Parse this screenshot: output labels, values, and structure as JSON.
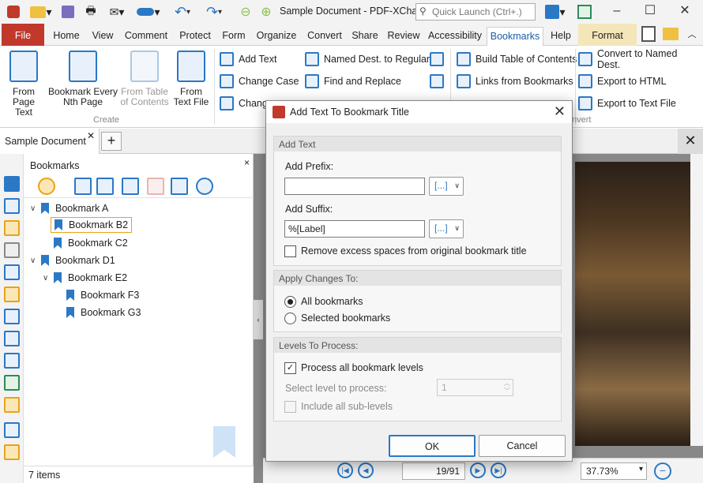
{
  "window": {
    "title": "Sample Document - PDF-XCha...",
    "quick_launch_placeholder": "Quick Launch (Ctrl+.)",
    "minimize": "–",
    "maximize": "☐",
    "close": "✕"
  },
  "menu_tabs": [
    "File",
    "Home",
    "View",
    "Comment",
    "Protect",
    "Form",
    "Organize",
    "Convert",
    "Share",
    "Review",
    "Accessibility",
    "Bookmarks",
    "Help",
    "Format"
  ],
  "ribbon": {
    "big_buttons": [
      {
        "label_line1": "From",
        "label_line2": "Page Text"
      },
      {
        "label_line1": "Bookmark Every",
        "label_line2": "Nth Page"
      },
      {
        "label_line1": "From Table",
        "label_line2": "of Contents"
      },
      {
        "label_line1": "From",
        "label_line2": "Text File"
      }
    ],
    "group_create": "Create",
    "group_convert": "nvert",
    "small_buttons": {
      "add_text": "Add Text",
      "change_case": "Change Case",
      "change_partial": "Chang",
      "named_dest": "Named Dest. to Regular",
      "find_replace": "Find and Replace",
      "build_toc": "Build Table of Contents",
      "links_from_bookmarks": "Links from Bookmarks",
      "convert_named": "Convert to Named Dest.",
      "export_html": "Export to HTML",
      "export_text": "Export to Text File"
    }
  },
  "doc_tab": {
    "label": "Sample Document",
    "close": "✕",
    "add": "+",
    "close_all": "✕"
  },
  "bookmarks_panel": {
    "title": "Bookmarks",
    "close": "×",
    "items": [
      {
        "label": "Bookmark A",
        "level": 0,
        "expanded": true
      },
      {
        "label": "Bookmark B2",
        "level": 1,
        "selected": true
      },
      {
        "label": "Bookmark C2",
        "level": 1
      },
      {
        "label": "Bookmark D1",
        "level": 0,
        "expanded": true
      },
      {
        "label": "Bookmark E2",
        "level": 1,
        "expanded": true
      },
      {
        "label": "Bookmark F3",
        "level": 2
      },
      {
        "label": "Bookmark G3",
        "level": 2
      }
    ],
    "status": "7 items"
  },
  "navigation": {
    "page_current": "19",
    "page_total": "91",
    "zoom": "37.73%"
  },
  "dialog": {
    "title": "Add Text To Bookmark Title",
    "close": "✕",
    "section_add_text": "Add Text",
    "prefix_label": "Add Prefix:",
    "prefix_value": "",
    "suffix_label": "Add Suffix:",
    "suffix_value": "%[Label]",
    "token_button": "[...]",
    "remove_spaces_label": "Remove excess spaces from original bookmark title",
    "remove_spaces_checked": false,
    "section_apply": "Apply Changes To:",
    "all_bookmarks": "All bookmarks",
    "selected_bookmarks": "Selected bookmarks",
    "apply_choice": "All bookmarks",
    "section_levels": "Levels To Process:",
    "process_all_label": "Process all bookmark levels",
    "process_all_checked": true,
    "select_level_label": "Select level to process:",
    "select_level_value": "1",
    "include_sublevels_label": "Include all sub-levels",
    "ok": "OK",
    "cancel": "Cancel"
  }
}
